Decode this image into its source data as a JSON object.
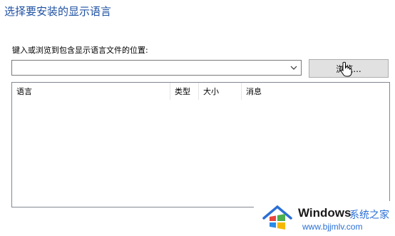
{
  "dialog": {
    "title": "选择要安装的显示语言",
    "prompt": "键入或浏览到包含显示语言文件的位置:",
    "path_value": "",
    "browse_label": "浏览..."
  },
  "language_list": {
    "columns": [
      "语言",
      "类型",
      "大小",
      "消息"
    ],
    "rows": []
  },
  "watermark": {
    "brand": "Windows",
    "site_name": "系统之家",
    "url": "www.bjjmlv.com"
  },
  "icons": {
    "combo": "chevron-down-icon",
    "cursor": "mouse-cursor-icon",
    "logo": "windows-logo-icon"
  },
  "colors": {
    "title": "#1e50a2",
    "button_bg": "#e1e1e1",
    "watermark_text": "#2a6fd6"
  }
}
